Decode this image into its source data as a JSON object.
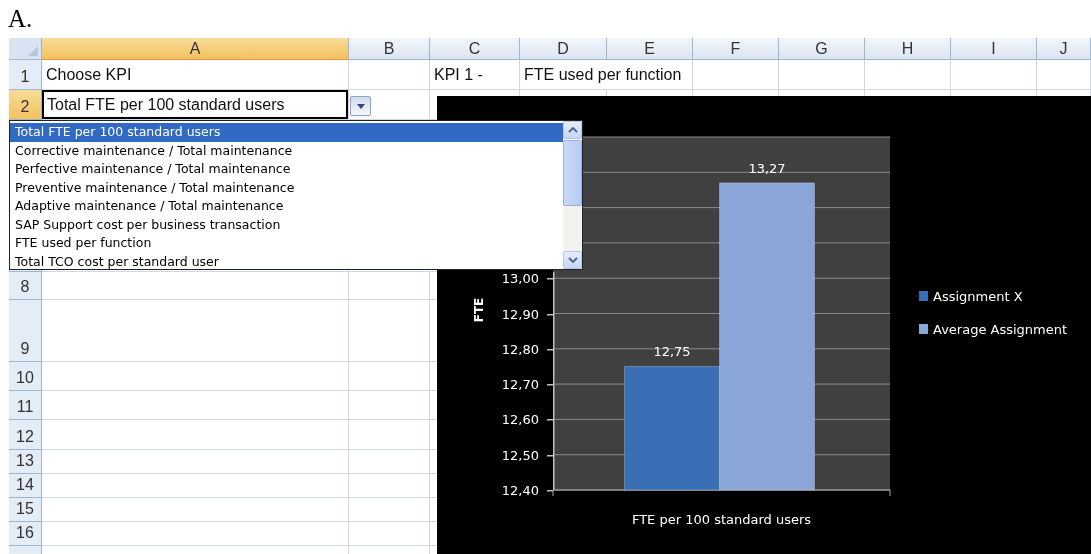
{
  "caption": "A.",
  "columns": [
    {
      "label": "A",
      "selected": true
    },
    {
      "label": "B",
      "selected": false
    },
    {
      "label": "C",
      "selected": false
    },
    {
      "label": "D",
      "selected": false
    },
    {
      "label": "E",
      "selected": false
    },
    {
      "label": "F",
      "selected": false
    },
    {
      "label": "G",
      "selected": false
    },
    {
      "label": "H",
      "selected": false
    },
    {
      "label": "I",
      "selected": false
    },
    {
      "label": "J",
      "selected": false
    }
  ],
  "rows": [
    {
      "number": "1",
      "selected": false
    },
    {
      "number": "2",
      "selected": true
    },
    {
      "number": "8",
      "selected": false
    },
    {
      "number": "9",
      "selected": false
    },
    {
      "number": "10",
      "selected": false
    },
    {
      "number": "11",
      "selected": false
    },
    {
      "number": "12",
      "selected": false
    },
    {
      "number": "13",
      "selected": false
    },
    {
      "number": "14",
      "selected": false
    },
    {
      "number": "15",
      "selected": false
    },
    {
      "number": "16",
      "selected": false
    }
  ],
  "kpi_chooser": {
    "label": "Choose KPI",
    "value": "Total FTE per 100 standard users",
    "expanded": true,
    "options": [
      {
        "label": "Total FTE per 100 standard users",
        "selected": true
      },
      {
        "label": "Corrective maintenance / Total maintenance",
        "selected": false
      },
      {
        "label": "Perfective maintenance / Total maintenance",
        "selected": false
      },
      {
        "label": "Preventive maintenance / Total maintenance",
        "selected": false
      },
      {
        "label": "Adaptive maintenance / Total maintenance",
        "selected": false
      },
      {
        "label": "SAP Support cost per business transaction",
        "selected": false
      },
      {
        "label": "FTE used per function",
        "selected": false
      },
      {
        "label": "Total TCO cost per standard user",
        "selected": false
      }
    ]
  },
  "kpi_heading": {
    "number": "KPI 1 -",
    "name": "FTE used per function"
  },
  "chart": {
    "chart_data": {
      "type": "bar",
      "ylabel": "FTE",
      "categories": [
        "FTE per 100 standard users"
      ],
      "series": [
        {
          "name": "Assignment X",
          "color": "#3a6fb6",
          "values": [
            12.75
          ]
        },
        {
          "name": "Average Assignment",
          "color": "#8aa6d8",
          "values": [
            13.27
          ]
        }
      ],
      "ylim": [
        12.4,
        13.4
      ],
      "grid": true,
      "legend": true,
      "yticks": [
        {
          "value": 12.4,
          "label": "12,40"
        },
        {
          "value": 12.5,
          "label": "12,50"
        },
        {
          "value": 12.6,
          "label": "12,60"
        },
        {
          "value": 12.7,
          "label": "12,70"
        },
        {
          "value": 12.8,
          "label": "12,80"
        },
        {
          "value": 12.9,
          "label": "12,90"
        },
        {
          "value": 13.0,
          "label": "13,00"
        }
      ],
      "value_labels": [
        "12,75",
        "13,27"
      ]
    }
  }
}
